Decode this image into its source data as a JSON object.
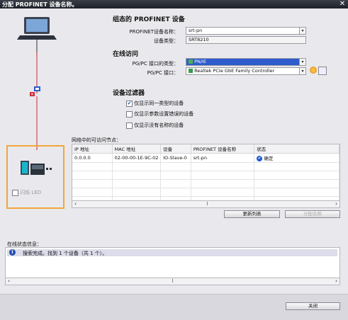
{
  "window": {
    "title": "分配 PROFINET 设备名称。",
    "close_glyph": "✕"
  },
  "configured": {
    "heading": "组态的 PROFINET 设备",
    "name_label": "PROFINET设备名称：",
    "name_value": "srt-pn",
    "type_label": "设备类型：",
    "type_value": "SRT8210"
  },
  "online": {
    "heading": "在线访问",
    "iface_type_label": "PG/PC 接口的类型：",
    "iface_type_value": "PN/IE",
    "iface_label": "PG/PC 接口：",
    "iface_value": "Realtek PCIe GbE Family Controller"
  },
  "filter": {
    "heading": "设备过滤器",
    "opt1": "仅显示同一类型的设备",
    "opt1_checked": true,
    "opt2": "仅显示参数设置错误的设备",
    "opt2_checked": false,
    "opt3": "仅显示没有名称的设备",
    "opt3_checked": false
  },
  "table": {
    "caption": "网络中的可访问节点：",
    "columns": [
      "IP 地址",
      "MAC 地址",
      "设备",
      "PROFINET 设备名称",
      "状态"
    ],
    "rows": [
      [
        "0.0.0.0",
        "02-00-00-1E-9C-02",
        "IO-Slave-0",
        "srt-pn",
        "确定"
      ]
    ],
    "status_icon": "check-circle-icon"
  },
  "buttons": {
    "update": "更新列表",
    "assign": "分配名称",
    "close": "关闭"
  },
  "left": {
    "led_label": "闪烁 LED",
    "led_checked": false
  },
  "status": {
    "heading": "在线状态信息：",
    "message": "搜索完成。找到 1 个设备（共 1 个）。"
  },
  "colors": {
    "accent": "#2e5ccd",
    "highlight_border": "#f3a53b",
    "titlebar": "#1d2027"
  }
}
